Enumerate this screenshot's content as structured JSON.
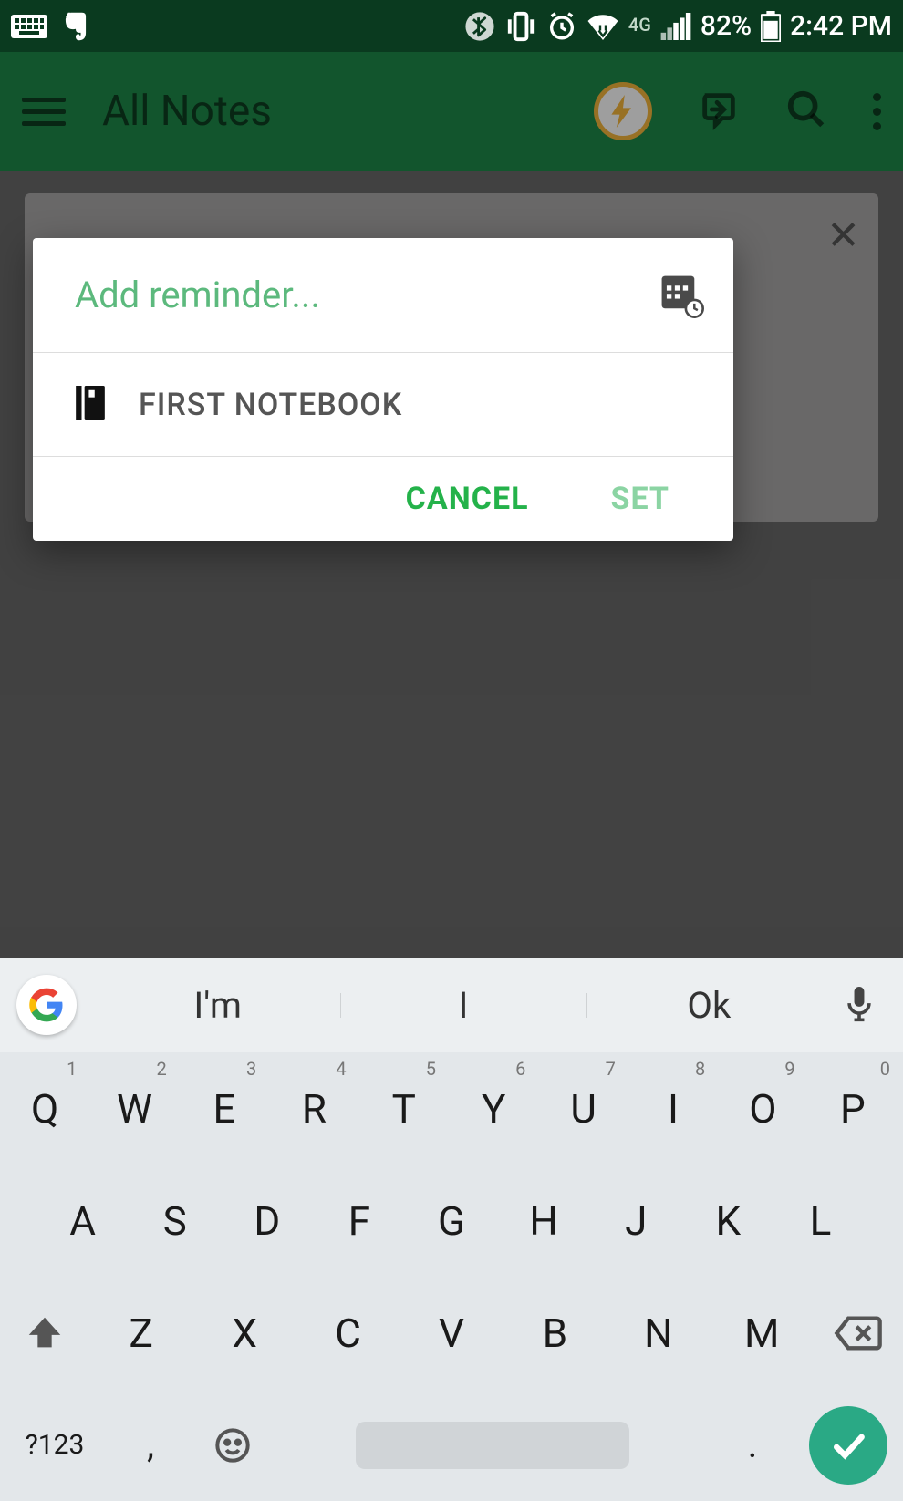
{
  "status_bar": {
    "battery_pct": "82%",
    "time": "2:42 PM",
    "carrier_label": "4G"
  },
  "app_bar": {
    "title": "All Notes"
  },
  "dialog": {
    "reminder_placeholder": "Add reminder...",
    "notebook_label": "FIRST NOTEBOOK",
    "cancel_label": "CANCEL",
    "set_label": "SET"
  },
  "keyboard": {
    "suggestions": [
      "I'm",
      "I",
      "Ok"
    ],
    "row1": [
      {
        "k": "Q",
        "n": "1"
      },
      {
        "k": "W",
        "n": "2"
      },
      {
        "k": "E",
        "n": "3"
      },
      {
        "k": "R",
        "n": "4"
      },
      {
        "k": "T",
        "n": "5"
      },
      {
        "k": "Y",
        "n": "6"
      },
      {
        "k": "U",
        "n": "7"
      },
      {
        "k": "I",
        "n": "8"
      },
      {
        "k": "O",
        "n": "9"
      },
      {
        "k": "P",
        "n": "0"
      }
    ],
    "row2": [
      "A",
      "S",
      "D",
      "F",
      "G",
      "H",
      "J",
      "K",
      "L"
    ],
    "row3": [
      "Z",
      "X",
      "C",
      "V",
      "B",
      "N",
      "M"
    ],
    "symbols_label": "?123",
    "comma": ",",
    "dot": "."
  }
}
